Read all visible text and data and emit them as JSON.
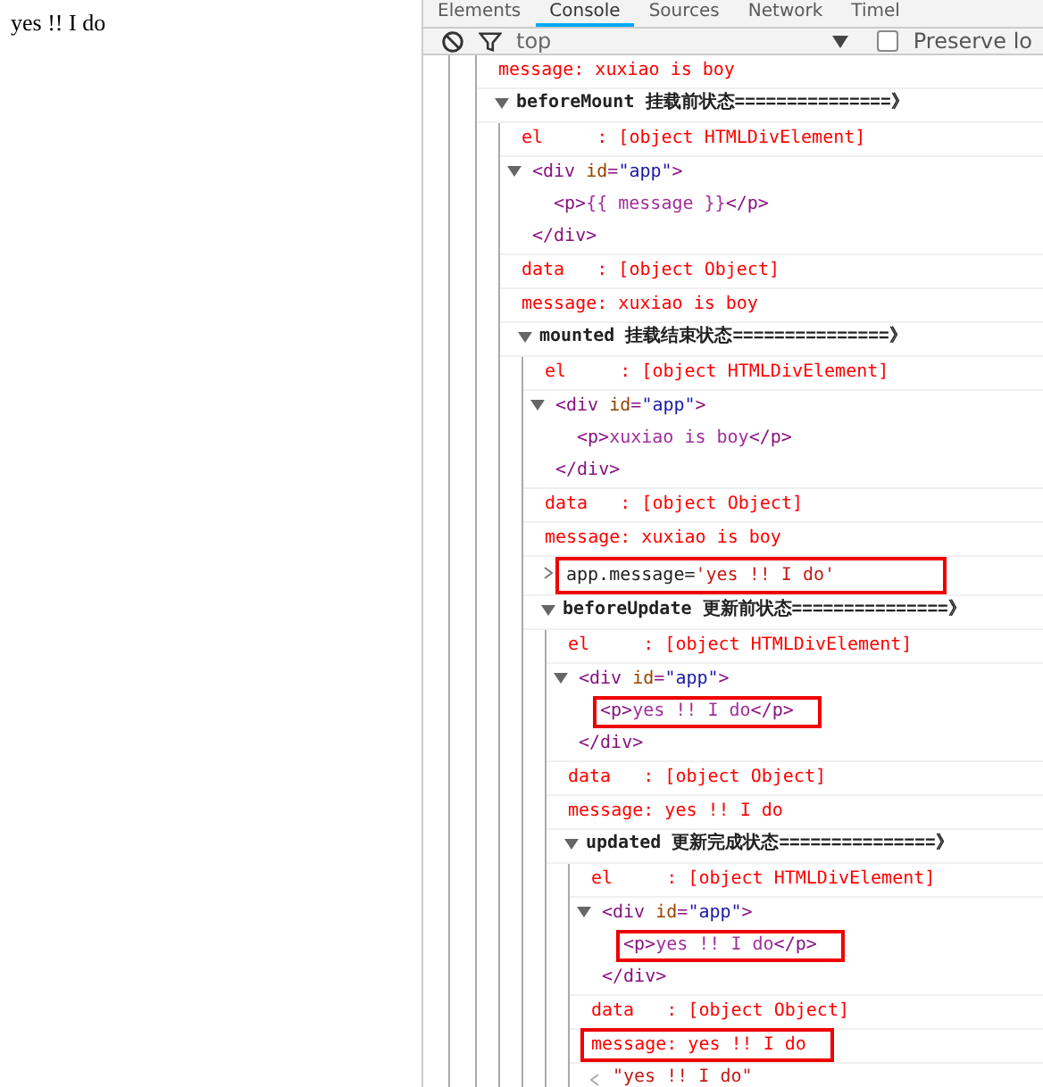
{
  "page": {
    "text": "yes !! I do"
  },
  "devtools": {
    "tabs": [
      {
        "label": "Elements",
        "selected": false
      },
      {
        "label": "Console",
        "selected": true
      },
      {
        "label": "Sources",
        "selected": false
      },
      {
        "label": "Network",
        "selected": false
      },
      {
        "label": "Timel",
        "selected": false
      }
    ],
    "toolbar": {
      "context": "top",
      "preserve_log": {
        "label": "Preserve lo",
        "checked": false
      }
    },
    "log": [
      {
        "kind": "text",
        "text": "message: xuxiao is boy",
        "highlighted": false
      },
      {
        "kind": "group",
        "name": "beforeMount",
        "title": "挂载前状态===============》",
        "expanded": true,
        "children": [
          {
            "kind": "text",
            "text": "el     : [object HTMLDivElement]",
            "highlighted": false
          },
          {
            "kind": "dom",
            "expanded": true,
            "parts": [
              {
                "kind": "tag",
                "text": "<div"
              },
              {
                "kind": "attr",
                "text": " id"
              },
              {
                "kind": "tag",
                "text": "="
              },
              {
                "kind": "value",
                "text": "\"app\""
              },
              {
                "kind": "tag",
                "text": ">"
              }
            ],
            "highlighted": false,
            "children": [
              {
                "parts": [
                  {
                    "kind": "tag",
                    "text": "<p>"
                  },
                  {
                    "kind": "content",
                    "text": "{{ message }}"
                  },
                  {
                    "kind": "tag",
                    "text": "</p>"
                  }
                ],
                "highlighted": false
              }
            ],
            "close": "</div>"
          },
          {
            "kind": "text",
            "text": "data   : [object Object]",
            "highlighted": false
          },
          {
            "kind": "text",
            "text": "message: xuxiao is boy",
            "highlighted": false
          },
          {
            "kind": "group",
            "name": "mounted",
            "title": "挂载结束状态===============》",
            "expanded": true,
            "children": [
              {
                "kind": "text",
                "text": "el     : [object HTMLDivElement]",
                "highlighted": false
              },
              {
                "kind": "dom",
                "expanded": true,
                "parts": [
                  {
                    "kind": "tag",
                    "text": "<div"
                  },
                  {
                    "kind": "attr",
                    "text": " id"
                  },
                  {
                    "kind": "tag",
                    "text": "="
                  },
                  {
                    "kind": "value",
                    "text": "\"app\""
                  },
                  {
                    "kind": "tag",
                    "text": ">"
                  }
                ],
                "highlighted": false,
                "children": [
                  {
                    "parts": [
                      {
                        "kind": "tag",
                        "text": "<p>"
                      },
                      {
                        "kind": "content",
                        "text": "xuxiao is boy"
                      },
                      {
                        "kind": "tag",
                        "text": "</p>"
                      }
                    ],
                    "highlighted": false
                  }
                ],
                "close": "</div>"
              },
              {
                "kind": "text",
                "text": "data   : [object Object]",
                "highlighted": false
              },
              {
                "kind": "text",
                "text": "message: xuxiao is boy",
                "highlighted": false
              },
              {
                "kind": "input",
                "command": "app.message=",
                "value": "'yes !! I do'",
                "highlighted": true
              },
              {
                "kind": "group",
                "name": "beforeUpdate",
                "title": "更新前状态===============》",
                "expanded": true,
                "children": [
                  {
                    "kind": "text",
                    "text": "el     : [object HTMLDivElement]",
                    "highlighted": false
                  },
                  {
                    "kind": "dom",
                    "expanded": true,
                    "parts": [
                      {
                        "kind": "tag",
                        "text": "<div"
                      },
                      {
                        "kind": "attr",
                        "text": " id"
                      },
                      {
                        "kind": "tag",
                        "text": "="
                      },
                      {
                        "kind": "value",
                        "text": "\"app\""
                      },
                      {
                        "kind": "tag",
                        "text": ">"
                      }
                    ],
                    "highlighted": false,
                    "children": [
                      {
                        "parts": [
                          {
                            "kind": "tag",
                            "text": "<p>"
                          },
                          {
                            "kind": "content",
                            "text": "yes !! I do"
                          },
                          {
                            "kind": "tag",
                            "text": "</p>"
                          }
                        ],
                        "highlighted": true
                      }
                    ],
                    "close": "</div>"
                  },
                  {
                    "kind": "text",
                    "text": "data   : [object Object]",
                    "highlighted": false
                  },
                  {
                    "kind": "text",
                    "text": "message: yes !! I do",
                    "highlighted": false
                  },
                  {
                    "kind": "group",
                    "name": "updated",
                    "title": "更新完成状态===============》",
                    "expanded": true,
                    "children": [
                      {
                        "kind": "text",
                        "text": "el     : [object HTMLDivElement]",
                        "highlighted": false
                      },
                      {
                        "kind": "dom",
                        "expanded": true,
                        "parts": [
                          {
                            "kind": "tag",
                            "text": "<div"
                          },
                          {
                            "kind": "attr",
                            "text": " id"
                          },
                          {
                            "kind": "tag",
                            "text": "="
                          },
                          {
                            "kind": "value",
                            "text": "\"app\""
                          },
                          {
                            "kind": "tag",
                            "text": ">"
                          }
                        ],
                        "highlighted": false,
                        "children": [
                          {
                            "parts": [
                              {
                                "kind": "tag",
                                "text": "<p>"
                              },
                              {
                                "kind": "content",
                                "text": "yes !! I do"
                              },
                              {
                                "kind": "tag",
                                "text": "</p>"
                              }
                            ],
                            "highlighted": true
                          }
                        ],
                        "close": "</div>"
                      },
                      {
                        "kind": "text",
                        "text": "data   : [object Object]",
                        "highlighted": false
                      },
                      {
                        "kind": "text",
                        "text": "message: yes !! I do",
                        "highlighted": true
                      },
                      {
                        "kind": "result",
                        "value": "\"yes !! I do\""
                      }
                    ]
                  }
                ]
              }
            ]
          }
        ]
      }
    ]
  }
}
